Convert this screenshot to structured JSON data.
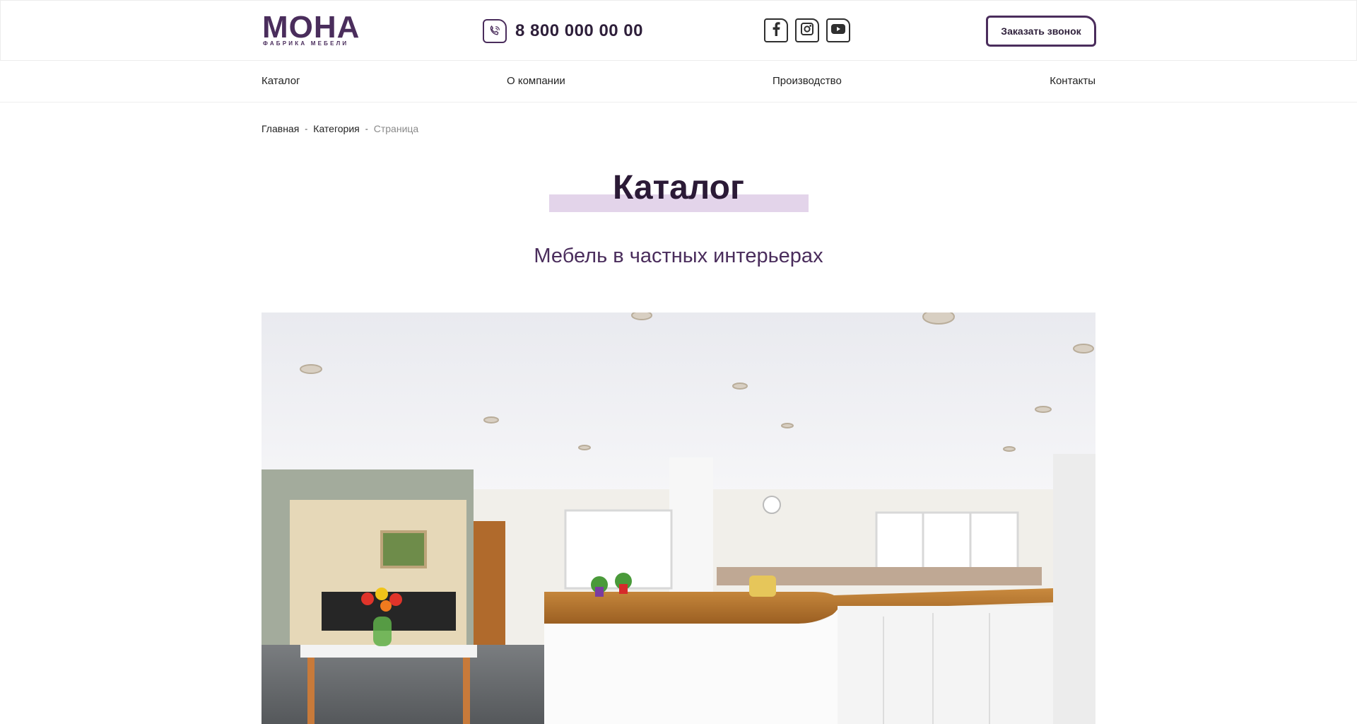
{
  "header": {
    "logo_main": "МОНА",
    "logo_sub": "фабрика мебели",
    "phone": "8 800 000 00 00",
    "callback_label": "Заказать звонок",
    "social": [
      {
        "icon": "facebook-icon"
      },
      {
        "icon": "instagram-icon"
      },
      {
        "icon": "youtube-icon"
      }
    ]
  },
  "nav": {
    "items": [
      {
        "label": "Каталог"
      },
      {
        "label": "О компании"
      },
      {
        "label": "Производство"
      },
      {
        "label": "Контакты"
      }
    ]
  },
  "breadcrumb": {
    "items": [
      {
        "label": "Главная"
      },
      {
        "label": "Категория"
      }
    ],
    "current": "Страница",
    "separator": "-"
  },
  "main": {
    "title": "Каталог",
    "subtitle": "Мебель в частных интерьерах"
  },
  "colors": {
    "brand": "#4a2d5c",
    "title_highlight": "#e3d4ea",
    "text": "#1b1b1b"
  }
}
